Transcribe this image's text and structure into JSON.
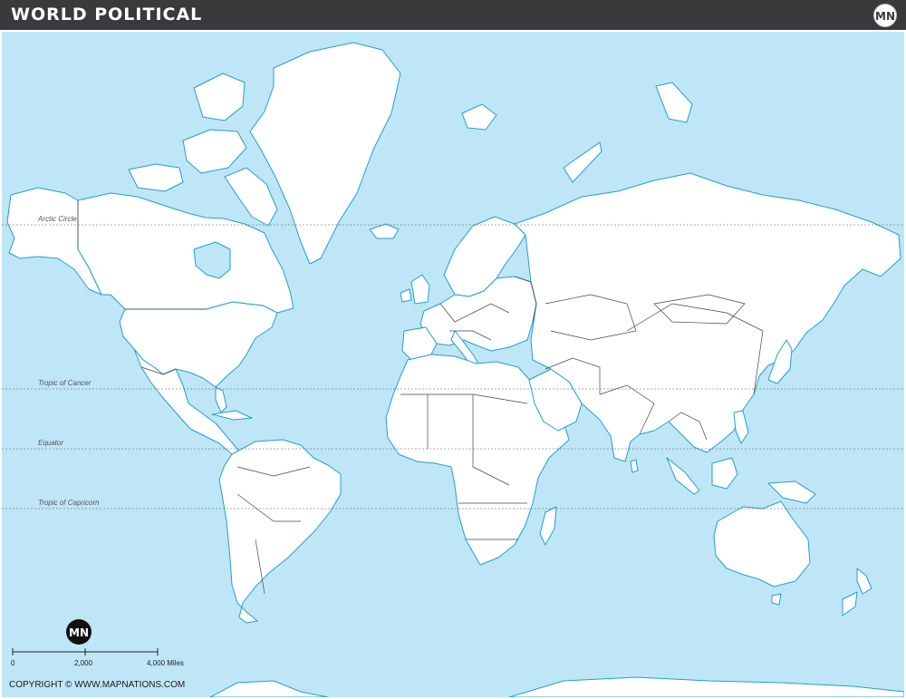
{
  "header": {
    "title": "WORLD POLITICAL",
    "logo_text": "MN"
  },
  "map": {
    "ocean_color": "#bfe6f7",
    "land_color": "#ffffff",
    "coast_color": "#1fa0cf",
    "border_color": "#444444",
    "latitude_lines": {
      "arctic": "Arctic Circle",
      "cancer": "Tropic of Cancer",
      "equator": "Equator",
      "capricorn": "Tropic of Capricorn"
    }
  },
  "scale": {
    "logo_text": "MN",
    "tick_0": "0",
    "tick_1": "2,000",
    "tick_2": "4,000 Miles"
  },
  "copyright": "COPYRIGHT © WWW.MAPNATIONS.COM"
}
